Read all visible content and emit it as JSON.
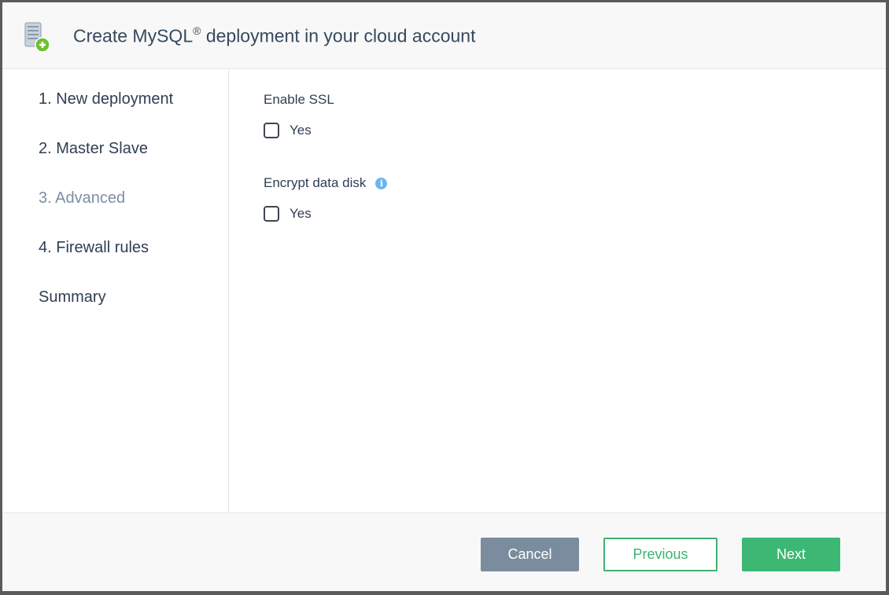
{
  "header": {
    "title": "Create MySQL",
    "title_sup": "®",
    "title_rest": " deployment in your cloud account",
    "icon": "database-add-icon"
  },
  "sidebar": {
    "steps": [
      {
        "label": "1. New deployment",
        "active": false
      },
      {
        "label": "2. Master Slave",
        "active": false
      },
      {
        "label": "3. Advanced",
        "active": true
      },
      {
        "label": "4. Firewall rules",
        "active": false
      },
      {
        "label": "Summary",
        "active": false
      }
    ]
  },
  "form": {
    "ssl": {
      "label": "Enable SSL",
      "option_label": "Yes",
      "checked": false
    },
    "encrypt": {
      "label": "Encrypt data disk",
      "info_icon": "info-icon",
      "info_glyph": "i",
      "option_label": "Yes",
      "checked": false
    }
  },
  "footer": {
    "cancel_label": "Cancel",
    "previous_label": "Previous",
    "next_label": "Next"
  },
  "colors": {
    "primary": "#3cb874",
    "secondary": "#7a8c9d",
    "text": "#2f3e52",
    "active_step": "#7d8ea3",
    "info": "#6bb6f0"
  }
}
